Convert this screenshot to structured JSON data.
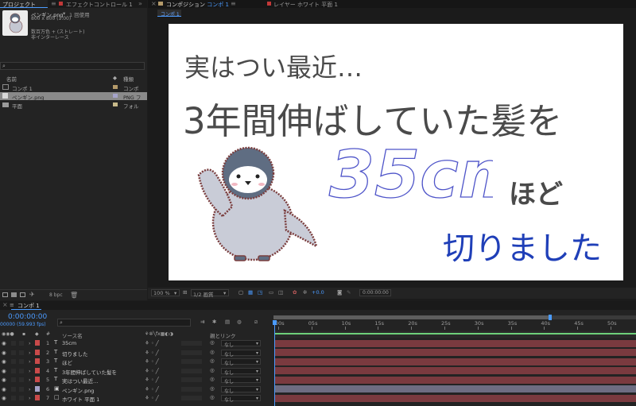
{
  "project_panel": {
    "tab_project": "プロジェクト",
    "tab_effect": "エフェクトコントロール 1",
    "selected_item": "ペンギン.png",
    "usage": "1 回使用",
    "size": "800 x 800 (1.00)",
    "color_info": "数百万色 + (ストレート)",
    "interlace": "非インターレース",
    "search_placeholder": "",
    "col_name": "名前",
    "col_type": "種類",
    "items": [
      {
        "name": "コンポ 1",
        "type": "コンポ",
        "color": "#b49a6a"
      },
      {
        "name": "ペンギン.png",
        "type": "PNG フ",
        "color": "#a5a3c9"
      },
      {
        "name": "平面",
        "type": "フォル",
        "color": "#c7b98a"
      }
    ],
    "bpc": "8 bpc"
  },
  "comp_panel": {
    "tab_comp_prefix": "コンポジション",
    "tab_comp_name": "コンポ 1",
    "tab_layer": "レイヤー ホワイト 平面 1",
    "subtab": "コンポ 1",
    "zoom": "100 %",
    "resolution": "1/2 画質",
    "exposure": "+0.0",
    "timecode": "0:00:00:00"
  },
  "canvas_text": {
    "line1": "実はつい最近…",
    "line2": "3年間伸ばしていた髪を",
    "big": "35cm",
    "hodo": "ほど",
    "cut": "切りました"
  },
  "timeline": {
    "tab_label": "コンポ 1",
    "timecode": "0:00:00:00",
    "fps": "00000 (59.993 fps)",
    "col_source": "ソース名",
    "col_parent": "親とリンク",
    "ruler_labels": [
      "00s",
      "05s",
      "10s",
      "15s",
      "20s",
      "25s",
      "30s",
      "35s",
      "40s",
      "45s",
      "50s"
    ],
    "layers": [
      {
        "num": "1",
        "type": "T",
        "name": "35cm",
        "color": "#c94a4a",
        "parent": "なし"
      },
      {
        "num": "2",
        "type": "T",
        "name": "切りました",
        "color": "#c94a4a",
        "parent": "なし"
      },
      {
        "num": "3",
        "type": "T",
        "name": "ほど",
        "color": "#c94a4a",
        "parent": "なし"
      },
      {
        "num": "4",
        "type": "T",
        "name": "3年間伸ばしていた髪を",
        "color": "#c94a4a",
        "parent": "なし"
      },
      {
        "num": "5",
        "type": "T",
        "name": "実はつい最近…",
        "color": "#c94a4a",
        "parent": "なし"
      },
      {
        "num": "6",
        "type": "img",
        "name": "ペンギン.png",
        "color": "#a5a3c9",
        "parent": "なし"
      },
      {
        "num": "7",
        "type": "solid",
        "name": "ホワイト 平面 1",
        "color": "#c94a4a",
        "parent": "なし"
      }
    ]
  },
  "colors": {
    "accent_blue": "#4b9bff",
    "layer_bar": "#7a3a3f",
    "layer_bar_img": "#6e6d82",
    "text_blue": "#1f3fb8"
  }
}
